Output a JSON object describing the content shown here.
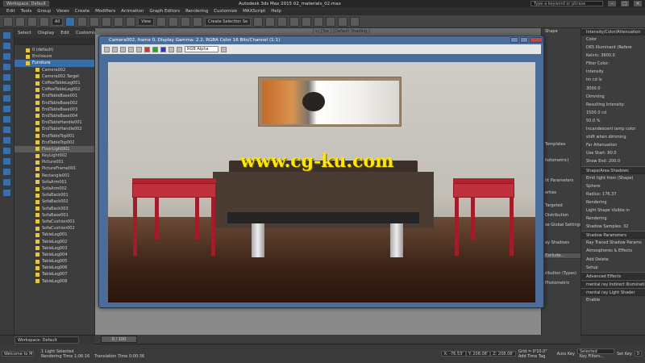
{
  "titlebar": {
    "workspace": "Workspace: Default",
    "title": "Autodesk 3ds Max 2015  02_materials_02.max",
    "search": "Type a keyword or phrase"
  },
  "menu": [
    "Edit",
    "Tools",
    "Group",
    "Views",
    "Create",
    "Modifiers",
    "Animation",
    "Graph Editors",
    "Rendering",
    "Customize",
    "MAXScript",
    "Help"
  ],
  "toolbar": {
    "filter": "All",
    "view": "View",
    "selection_set": "Create Selection Se"
  },
  "explorer": {
    "tabs": [
      "Select",
      "Display",
      "Edit",
      "Customize"
    ],
    "items": [
      "0 (default)",
      "Enclosure",
      "Furniture",
      "Camera002",
      "Camera002.Target",
      "CoffeeTableLeg001",
      "CoffeeTableLeg002",
      "EndTableBase001",
      "EndTableBase002",
      "EndTableBase003",
      "EndTableBase004",
      "EndTableHandle001",
      "EndTableHandle002",
      "EndTableTop001",
      "EndTableTop002",
      "FloorLight001",
      "KeyLight002",
      "Picture001",
      "PictureFrame001",
      "Rectangle001",
      "SofaArm001",
      "SofaArm002",
      "SofaBack001",
      "SofaBack002",
      "SofaBack003",
      "SofaBase001",
      "SofaCushion001",
      "SofaCushion002",
      "TableLeg001",
      "TableLeg002",
      "TableLeg003",
      "TableLeg004",
      "TableLeg005",
      "TableLeg006",
      "TableLeg007",
      "TableLeg008"
    ],
    "selected": "FloorLight001",
    "workspace": "Workspace: Default"
  },
  "viewport": {
    "label": "[+] [Top ] [Default Shading ]"
  },
  "frame_window": {
    "title": "Camera002, frame 0, Display Gamma: 2.2, RGBA Color 16 Bits/Channel (1:1)",
    "channel": "RGB Alpha",
    "watermark": "www.cg-ku.com"
  },
  "mid_panel": [
    "Shape",
    "Templates",
    "hotometric)",
    "ht Parameters",
    "erties",
    "Targeted",
    "Distribution",
    "se Global Settings",
    "ay Shadows",
    "Exclude...",
    "ribution (Types)",
    "Photometric"
  ],
  "right_panel": {
    "header": "Intensity/Color/Attenuation",
    "rows": [
      "Color",
      "D65 Illuminant (Refere",
      "Kelvin: 3600.0",
      "Filter Color:",
      "Intensity",
      "lm   cd   lx",
      "3000.0",
      "Dimming",
      "Resulting Intensity:",
      "1500.0 cd",
      "50.0 %",
      "Incandescent lamp color",
      "shift when dimming",
      "Far Attenuation",
      "Use   Start: 80.0",
      "Show  End: 200.0",
      "Shape/Area Shadows",
      "Emit light from (Shape)",
      "Sphere",
      "Radius: 176.37",
      "Rendering",
      "Light Shape Visible in",
      "Rendering",
      "Shadow Samples: 32",
      "Shadow Parameters",
      "Ray Traced Shadow Params",
      "Atmospheres & Effects",
      "Add   Delete",
      "Setup",
      "Advanced Effects",
      "mental ray Indirect Illumination",
      "mental ray Light Shader",
      "Enable"
    ]
  },
  "timeline": {
    "frame": "0 / 100"
  },
  "status": {
    "script": "Welcome to M",
    "selected": "1 Light Selected",
    "rendering_time": "Rendering Time  1:06:16",
    "translation_time": "Translation Time  0:00:36",
    "x": "X: -76.53'",
    "y": "Y: 208.08'",
    "z": "Z: 208.08'",
    "grid": "Grid = 0'10.0\"",
    "add_time_tag": "Add Time Tag",
    "auto_key": "Auto Key",
    "set_key": "Set Key",
    "key_mode": "Selected",
    "key_filters": "Key Filters...",
    "frame": "0"
  },
  "colors": {
    "accent": "#3a6ea8",
    "watermark": "#ffe800",
    "table": "#b02330"
  }
}
